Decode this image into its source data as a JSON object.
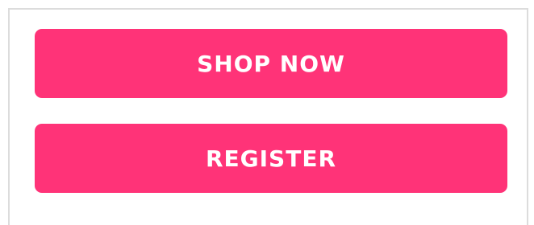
{
  "theme": {
    "button_color": "#ff3378",
    "button_text_color": "#ffffff"
  },
  "actions": {
    "shop_now_label": "SHOP NOW",
    "register_label": "REGISTER"
  }
}
